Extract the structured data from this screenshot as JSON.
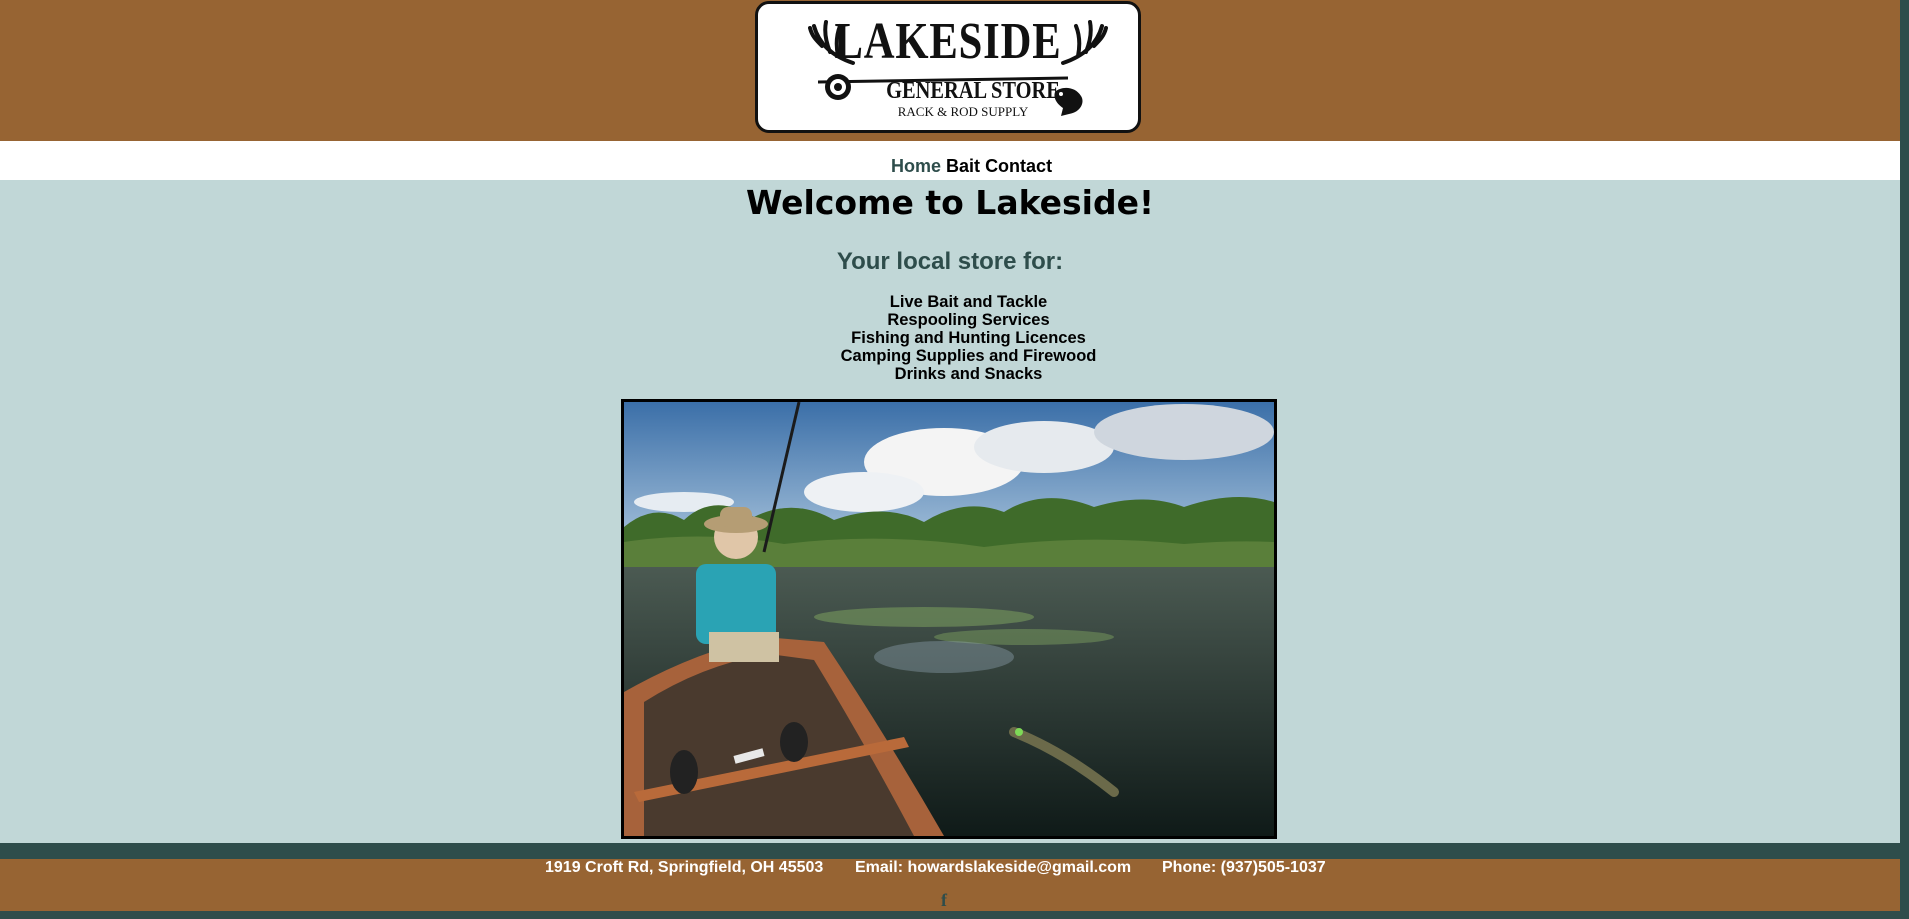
{
  "logo": {
    "title": "LAKESIDE",
    "subtitle": "GENERAL STORE",
    "tagline": "RACK & ROD SUPPLY",
    "icons": [
      "antler-icon",
      "reel-icon",
      "fish-icon"
    ]
  },
  "nav": {
    "items": [
      {
        "label": "Home",
        "active": true
      },
      {
        "label": "Bait",
        "active": false
      },
      {
        "label": "Contact",
        "active": false
      }
    ]
  },
  "main": {
    "title": "Welcome to Lakeside!",
    "subtitle": "Your local store for:",
    "services": [
      "Live Bait and Tackle",
      "Respooling Services",
      "Fishing and Hunting Licences",
      "Camping Supplies and Firewood",
      "Drinks and Snacks"
    ]
  },
  "footer": {
    "address": "1919 Croft Rd, Springfield, OH 45503",
    "email": "Email: howardslakeside@gmail.com",
    "phone": "Phone: (937)505-1037",
    "social_icon": "facebook-icon",
    "social_glyph": "f"
  },
  "colors": {
    "header_brown": "#976433",
    "body_bg": "#c1d7d7",
    "dark_teal": "#2e4d4b"
  }
}
